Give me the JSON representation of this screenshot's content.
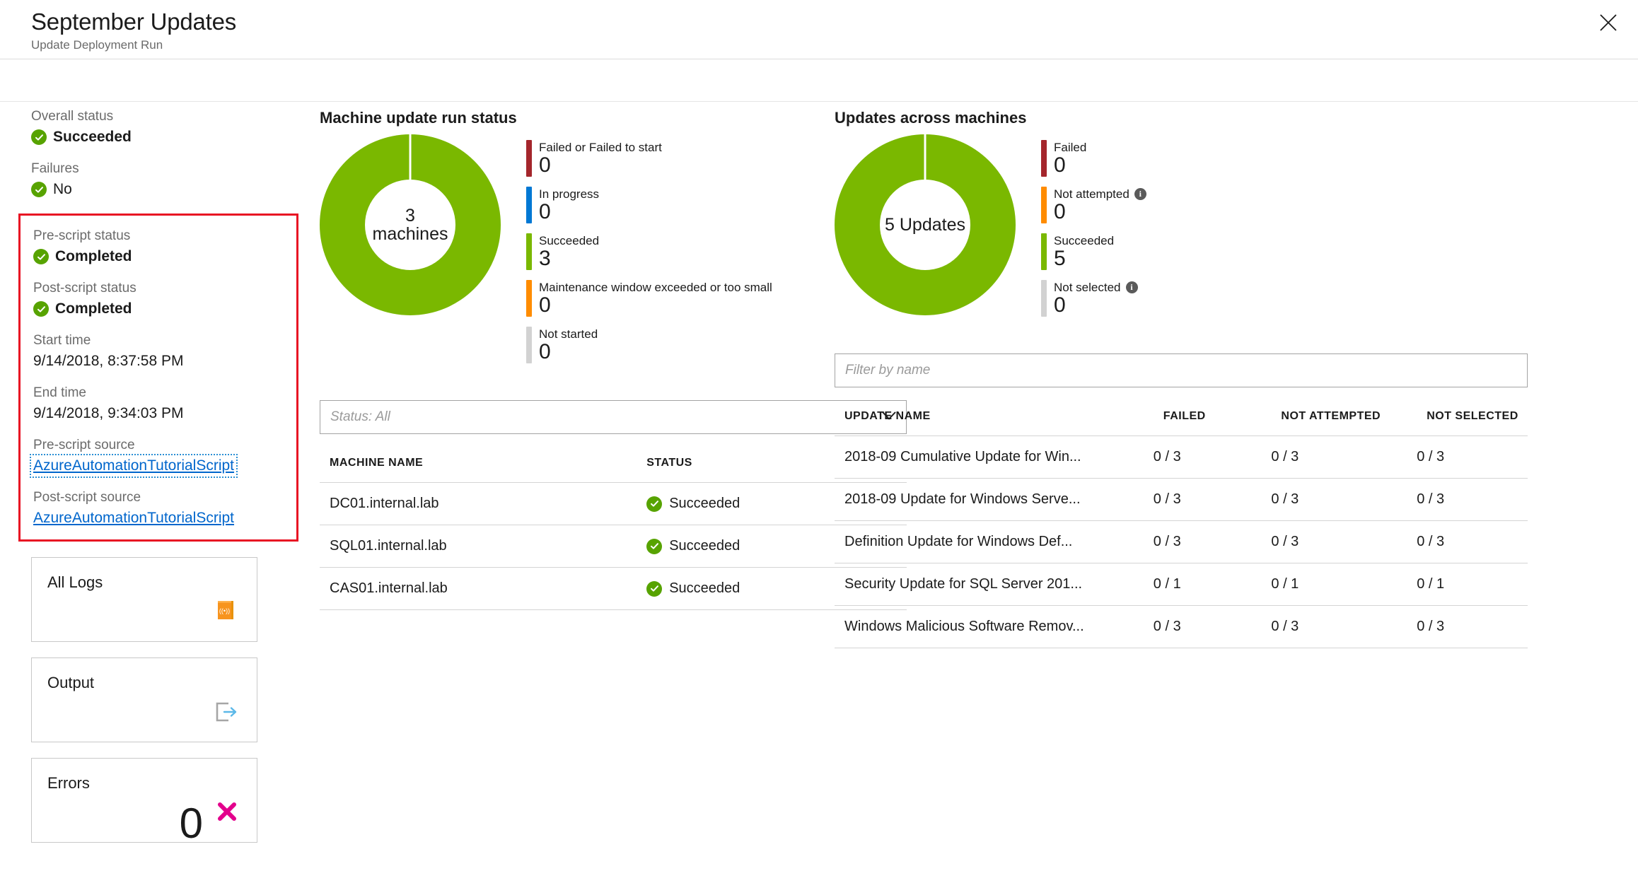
{
  "header": {
    "title": "September Updates",
    "subtitle": "Update Deployment Run",
    "close_icon": "close-icon"
  },
  "sidebar": {
    "overall_status": {
      "label": "Overall status",
      "value": "Succeeded",
      "icon": "success-check-icon"
    },
    "failures": {
      "label": "Failures",
      "value": "No",
      "icon": "success-check-icon"
    },
    "pre_script_status": {
      "label": "Pre-script status",
      "value": "Completed",
      "icon": "success-check-icon"
    },
    "post_script_status": {
      "label": "Post-script status",
      "value": "Completed",
      "icon": "success-check-icon"
    },
    "start_time": {
      "label": "Start time",
      "value": "9/14/2018, 8:37:58 PM"
    },
    "end_time": {
      "label": "End time",
      "value": "9/14/2018, 9:34:03 PM"
    },
    "pre_script_source": {
      "label": "Pre-script source",
      "value": "AzureAutomationTutorialScript"
    },
    "post_script_source": {
      "label": "Post-script source",
      "value": "AzureAutomationTutorialScript"
    },
    "cards": [
      {
        "title": "All Logs",
        "icon": "logs-book-icon",
        "value": ""
      },
      {
        "title": "Output",
        "icon": "output-export-icon",
        "value": ""
      },
      {
        "title": "Errors",
        "icon": "error-x-icon",
        "value": "0"
      }
    ]
  },
  "machine_panel": {
    "title": "Machine update run status",
    "filter": {
      "placeholder": "Status: All",
      "chevron": "chevron-down-icon"
    },
    "columns": [
      "MACHINE NAME",
      "STATUS"
    ],
    "rows": [
      {
        "name": "DC01.internal.lab",
        "status": "Succeeded"
      },
      {
        "name": "SQL01.internal.lab",
        "status": "Succeeded"
      },
      {
        "name": "CAS01.internal.lab",
        "status": "Succeeded"
      }
    ]
  },
  "updates_panel": {
    "title": "Updates across machines",
    "filter": {
      "placeholder": "Filter by name"
    },
    "columns": [
      "UPDATE NAME",
      "FAILED",
      "NOT ATTEMPTED",
      "NOT SELECTED"
    ],
    "rows": [
      {
        "name": "2018-09 Cumulative Update for Win...",
        "failed": "0 / 3",
        "not_attempted": "0 / 3",
        "not_selected": "0 / 3"
      },
      {
        "name": "2018-09 Update for Windows Serve...",
        "failed": "0 / 3",
        "not_attempted": "0 / 3",
        "not_selected": "0 / 3"
      },
      {
        "name": "Definition Update for Windows Def...",
        "failed": "0 / 3",
        "not_attempted": "0 / 3",
        "not_selected": "0 / 3"
      },
      {
        "name": "Security Update for SQL Server 201...",
        "failed": "0 / 1",
        "not_attempted": "0 / 1",
        "not_selected": "0 / 1"
      },
      {
        "name": "Windows Malicious Software Remov...",
        "failed": "0 / 3",
        "not_attempted": "0 / 3",
        "not_selected": "0 / 3"
      }
    ]
  },
  "chart_data": [
    {
      "type": "pie",
      "title": "Machine update run status",
      "center_text": "3\nmachines",
      "total": 3,
      "categories": [
        "Failed or Failed to start",
        "In progress",
        "Succeeded",
        "Maintenance window exceeded or too small",
        "Not started"
      ],
      "values": [
        0,
        0,
        3,
        0,
        0
      ],
      "colors": [
        "#a4262c",
        "#0078d4",
        "#7ab800",
        "#ff8c00",
        "#d2d2d2"
      ],
      "legend_position": "right"
    },
    {
      "type": "pie",
      "title": "Updates across machines",
      "center_text": "5 Updates",
      "total": 5,
      "categories": [
        "Failed",
        "Not attempted",
        "Succeeded",
        "Not selected"
      ],
      "values": [
        0,
        0,
        5,
        0
      ],
      "colors": [
        "#a4262c",
        "#ff8c00",
        "#7ab800",
        "#d2d2d2"
      ],
      "info_icons": [
        false,
        true,
        false,
        true
      ],
      "legend_position": "right"
    }
  ]
}
